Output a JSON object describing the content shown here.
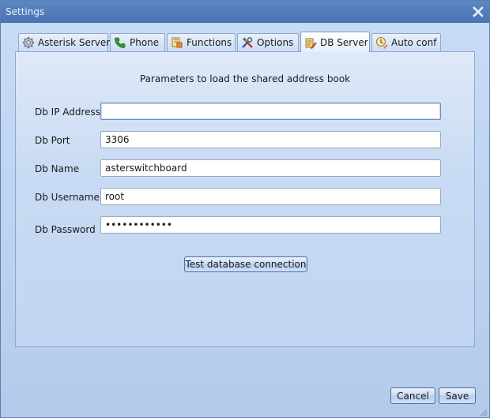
{
  "window": {
    "title": "Settings"
  },
  "tabs": [
    {
      "label": "Asterisk Server",
      "icon": "gear-icon",
      "active": false
    },
    {
      "label": "Phone",
      "icon": "phone-icon",
      "active": false
    },
    {
      "label": "Functions",
      "icon": "functions-icon",
      "active": false
    },
    {
      "label": "Options",
      "icon": "tools-icon",
      "active": false
    },
    {
      "label": "DB Server",
      "icon": "db-server-icon",
      "active": true
    },
    {
      "label": "Auto conf",
      "icon": "auto-conf-icon",
      "active": false
    }
  ],
  "panel": {
    "header": "Parameters to load the shared address book",
    "fields": {
      "ip": {
        "label": "Db IP Address",
        "value": ""
      },
      "port": {
        "label": "Db Port",
        "value": "3306"
      },
      "name": {
        "label": "Db Name",
        "value": "asterswitchboard"
      },
      "username": {
        "label": "Db Username",
        "value": "root"
      },
      "password": {
        "label": "Db Password",
        "value": "••••••••••••"
      }
    },
    "test_button_label": "Test database connection"
  },
  "footer": {
    "cancel_label": "Cancel",
    "save_label": "Save"
  }
}
